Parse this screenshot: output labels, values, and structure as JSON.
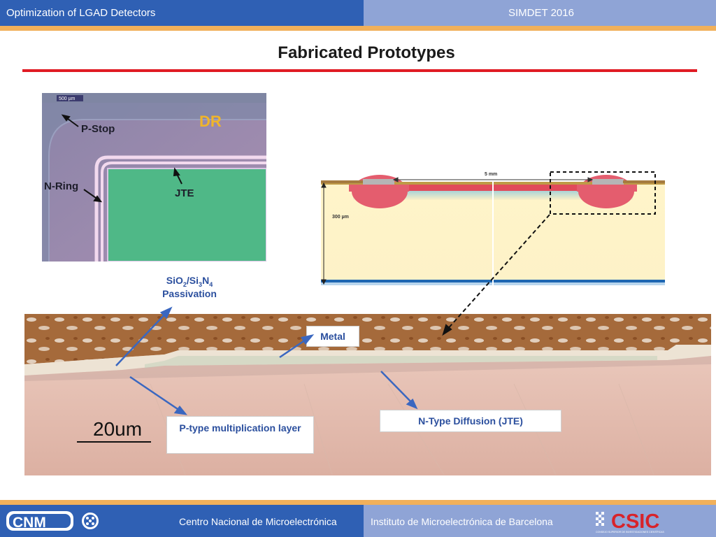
{
  "header": {
    "title": "Optimization of LGAD Detectors",
    "conference": "SIMDET 2016"
  },
  "slide": {
    "title": "Fabricated Prototypes"
  },
  "micrograph": {
    "scale": "500 µm",
    "region": "DR",
    "labels": {
      "p_stop": "P-Stop",
      "n_ring": "N-Ring",
      "jte": "JTE"
    }
  },
  "cross_section": {
    "width_label": "5 mm",
    "thickness_label": "300 µm"
  },
  "annotations": {
    "passivation_formula": {
      "p1": "SiO",
      "s1": "2",
      "p2": "/Si",
      "s2": "3",
      "p3": "N",
      "s3": "4"
    },
    "passivation_word": "Passivation",
    "metal": "Metal",
    "n_type": "N-Type Diffusion (JTE)",
    "p_type": "P-type multiplication layer",
    "scale_bar": "20um"
  },
  "footer": {
    "cnm_text": "Centro Nacional de Microelectrónica",
    "imb_text": "Instituto de Microelectrónica de Barcelona",
    "logo_left": "CNM",
    "logo_right": "CSIC",
    "logo_right_sub": "CONSEJO SUPERIOR DE INVESTIGACIONES CIENTÍFICAS"
  },
  "colors": {
    "header_blue": "#2f60b4",
    "header_light": "#8fa4d6",
    "accent_orange": "#f1b05a",
    "title_rule": "#e01b24",
    "annot_blue": "#2b4f9e"
  }
}
